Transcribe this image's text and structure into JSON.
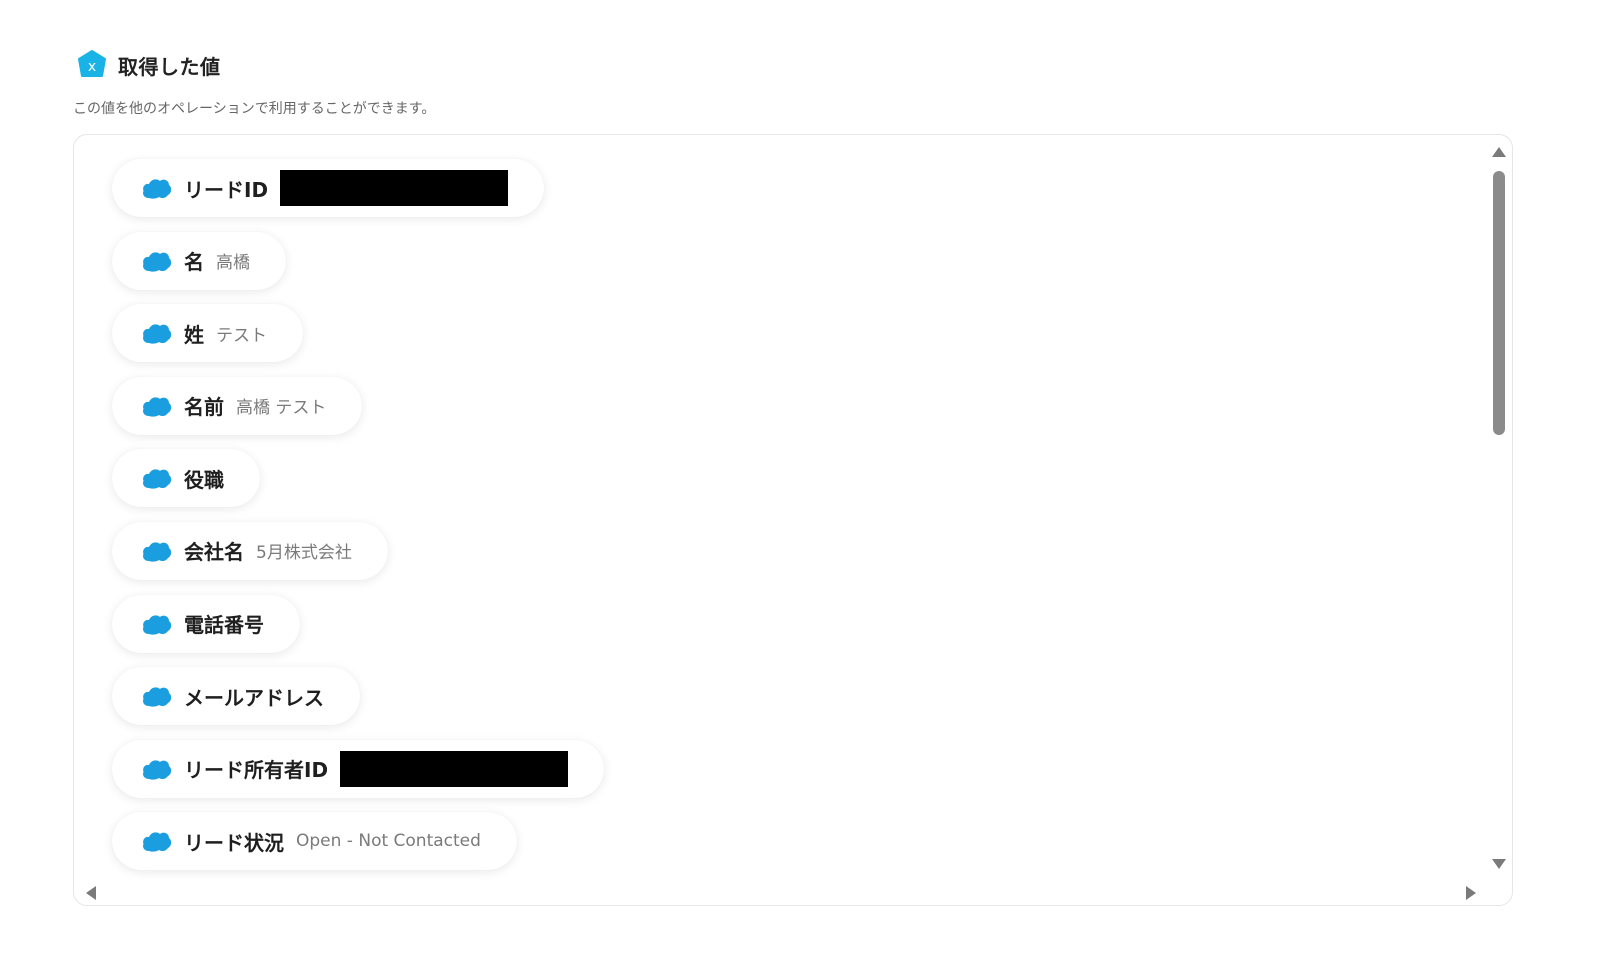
{
  "header": {
    "icon": "yoom-hexagon-icon",
    "icon_letter": "x",
    "title": "取得した値",
    "subtitle": "この値を他のオペレーションで利用することができます。"
  },
  "colors": {
    "accent": "#1ab3e6",
    "salesforce_cloud": "#1a9ee0",
    "redacted": "#000000"
  },
  "fields": [
    {
      "label": "リードID",
      "value": "",
      "redacted": true
    },
    {
      "label": "名",
      "value": "高橋"
    },
    {
      "label": "姓",
      "value": "テスト"
    },
    {
      "label": "名前",
      "value": "高橋 テスト"
    },
    {
      "label": "役職",
      "value": ""
    },
    {
      "label": "会社名",
      "value": "5月株式会社"
    },
    {
      "label": "電話番号",
      "value": ""
    },
    {
      "label": "メールアドレス",
      "value": ""
    },
    {
      "label": "リード所有者ID",
      "value": "",
      "redacted": true
    },
    {
      "label": "リード状況",
      "value": "Open - Not Contacted"
    }
  ]
}
